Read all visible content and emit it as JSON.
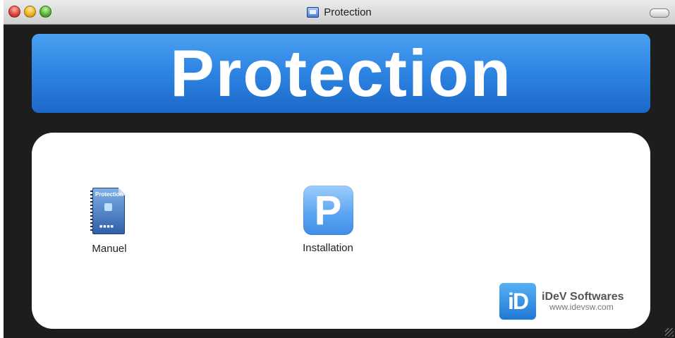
{
  "window": {
    "title": "Protection",
    "icon": "disk-image-icon"
  },
  "banner": {
    "text": "Protection",
    "color": "#2f86e4"
  },
  "items": [
    {
      "label": "Manuel",
      "icon": "document-icon"
    },
    {
      "label": "Installation",
      "icon": "installer-app-icon",
      "glyph": "P"
    }
  ],
  "branding": {
    "logo_text": "iD",
    "name": "iDeV Softwares",
    "url": "www.idevsw.com"
  },
  "doc_preview": {
    "title": "Protection"
  }
}
